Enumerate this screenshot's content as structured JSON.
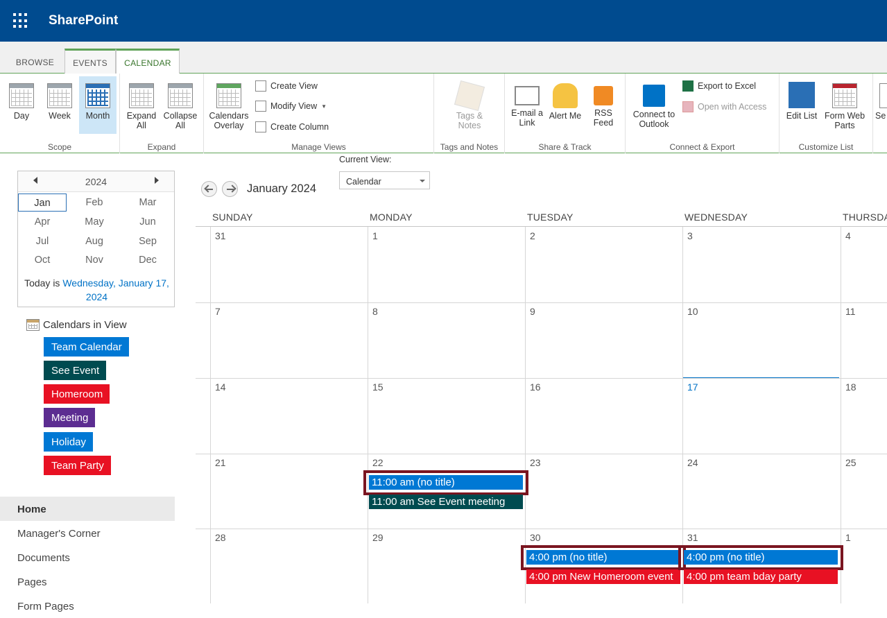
{
  "suite": {
    "brand": "SharePoint",
    "waffle_icon": "app-launcher-icon"
  },
  "ribbon_tabs": [
    "BROWSE",
    "EVENTS",
    "CALENDAR"
  ],
  "active_tab": "CALENDAR",
  "ribbon": {
    "scope": {
      "label": "Scope",
      "day": "Day",
      "week": "Week",
      "month": "Month",
      "selected": "Month"
    },
    "expand": {
      "label": "Expand",
      "expand_all": "Expand All",
      "collapse_all": "Collapse All"
    },
    "manage_views": {
      "label": "Manage Views",
      "calendars_overlay": "Calendars Overlay",
      "create_view": "Create View",
      "modify_view": "Modify View",
      "create_column": "Create Column",
      "current_view_label": "Current View:",
      "current_view_value": "Calendar"
    },
    "tags": {
      "label": "Tags and Notes",
      "tags_notes": "Tags & Notes"
    },
    "share": {
      "label": "Share & Track",
      "email_link": "E-mail a Link",
      "alert_me": "Alert Me",
      "rss_feed": "RSS Feed"
    },
    "connect": {
      "label": "Connect & Export",
      "connect_outlook": "Connect to Outlook",
      "export_excel": "Export to Excel",
      "open_access": "Open with Access"
    },
    "customize": {
      "label": "Customize List",
      "edit_list": "Edit List",
      "form_web_parts": "Form Web Parts",
      "settings_partial": "Se"
    }
  },
  "datepicker": {
    "year": "2024",
    "months": [
      "Jan",
      "Feb",
      "Mar",
      "Apr",
      "May",
      "Jun",
      "Jul",
      "Aug",
      "Sep",
      "Oct",
      "Nov",
      "Dec"
    ],
    "current_month": "Jan",
    "today_prefix": "Today is ",
    "today_link": "Wednesday, January 17, 2024"
  },
  "calendars_in_view": {
    "title": "Calendars in View",
    "items": [
      {
        "label": "Team Calendar",
        "color": "#0078d4"
      },
      {
        "label": "See Event",
        "color": "#004b50"
      },
      {
        "label": "Homeroom",
        "color": "#e81123"
      },
      {
        "label": "Meeting",
        "color": "#5c2d91"
      },
      {
        "label": "Holiday",
        "color": "#0078d4"
      },
      {
        "label": "Team Party",
        "color": "#e81123"
      }
    ]
  },
  "quick_launch": [
    "Home",
    "Manager's Corner",
    "Documents",
    "Pages",
    "Form Pages"
  ],
  "quick_launch_selected": "Home",
  "calendar": {
    "title": "January 2024",
    "day_headers": [
      "SUNDAY",
      "MONDAY",
      "TUESDAY",
      "WEDNESDAY",
      "THURSDAY"
    ],
    "weeks": [
      [
        "31",
        "1",
        "2",
        "3",
        "4"
      ],
      [
        "7",
        "8",
        "9",
        "10",
        "11"
      ],
      [
        "14",
        "15",
        "16",
        "17",
        "18"
      ],
      [
        "21",
        "22",
        "23",
        "24",
        "25"
      ],
      [
        "28",
        "29",
        "30",
        "31",
        "1"
      ]
    ],
    "today": "17",
    "events": [
      {
        "week": 3,
        "day": 1,
        "slot": 0,
        "text": "11:00 am (no title)",
        "color": "#0078d4",
        "highlighted": true
      },
      {
        "week": 3,
        "day": 1,
        "slot": 1,
        "text": "11:00 am See Event meeting",
        "color": "#004b50",
        "highlighted": false
      },
      {
        "week": 4,
        "day": 2,
        "slot": 0,
        "text": "4:00 pm (no title)",
        "color": "#0078d4",
        "highlighted": true
      },
      {
        "week": 4,
        "day": 2,
        "slot": 1,
        "text": "4:00 pm New Homeroom event",
        "color": "#e81123",
        "highlighted": false
      },
      {
        "week": 4,
        "day": 3,
        "slot": 0,
        "text": "4:00 pm (no title)",
        "color": "#0078d4",
        "highlighted": true
      },
      {
        "week": 4,
        "day": 3,
        "slot": 1,
        "text": "4:00 pm team bday party",
        "color": "#e81123",
        "highlighted": false
      }
    ]
  }
}
